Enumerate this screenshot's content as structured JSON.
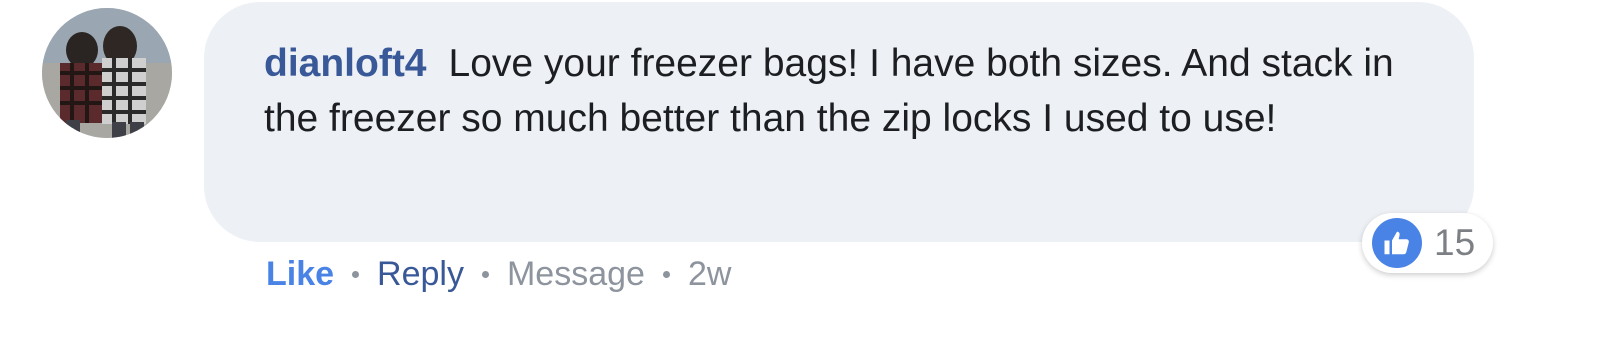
{
  "comment": {
    "author": "dianloft4",
    "text": "Love your freezer bags! I have both sizes. And stack in the freezer so much better than the zip locks I used to use!"
  },
  "reactions": {
    "icon": "thumbs-up-icon",
    "count": "15",
    "color": "#4a83e6"
  },
  "actions": {
    "like_label": "Like",
    "reply_label": "Reply",
    "message_label": "Message",
    "timestamp": "2w"
  },
  "colors": {
    "bubble_bg": "#edf0f5",
    "author": "#385898",
    "like": "#4a83e6",
    "muted": "#8d949e"
  }
}
